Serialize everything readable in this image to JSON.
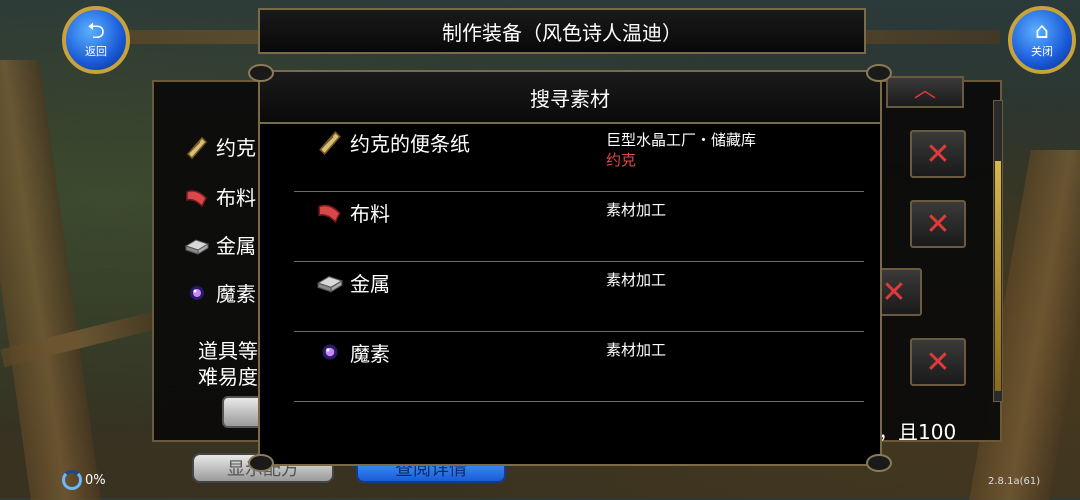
{
  "header": {
    "title": "制作装备（风色诗人温迪）"
  },
  "nav": {
    "back_label": "返回",
    "close_label": "关闭"
  },
  "back_panel": {
    "items": [
      {
        "label": "约克",
        "icon": "note-icon"
      },
      {
        "label": "布料",
        "icon": "cloth-icon"
      },
      {
        "label": "金属",
        "icon": "metal-icon"
      },
      {
        "label": "魔素",
        "icon": "magic-orb-icon"
      }
    ],
    "requirement_line1": "道具等",
    "requirement_line2": "难易度",
    "note": "，且100",
    "show_recipe_label": "显示配方",
    "view_details_label": "查阅详情"
  },
  "modal": {
    "title": "搜寻素材",
    "materials": [
      {
        "name": "约克的便条纸",
        "source": "巨型水晶工厂・储藏库",
        "location": "约克",
        "icon": "note-icon"
      },
      {
        "name": "布料",
        "source": "素材加工",
        "location": "",
        "icon": "cloth-icon"
      },
      {
        "name": "金属",
        "source": "素材加工",
        "location": "",
        "icon": "metal-icon"
      },
      {
        "name": "魔素",
        "source": "素材加工",
        "location": "",
        "icon": "magic-orb-icon"
      }
    ]
  },
  "status": {
    "progress": "0%",
    "version": "2.8.1a(61)"
  },
  "colors": {
    "accent_red": "#e04a4a",
    "frame_gold": "#7a6a48",
    "button_blue": "#1a5ad8"
  }
}
